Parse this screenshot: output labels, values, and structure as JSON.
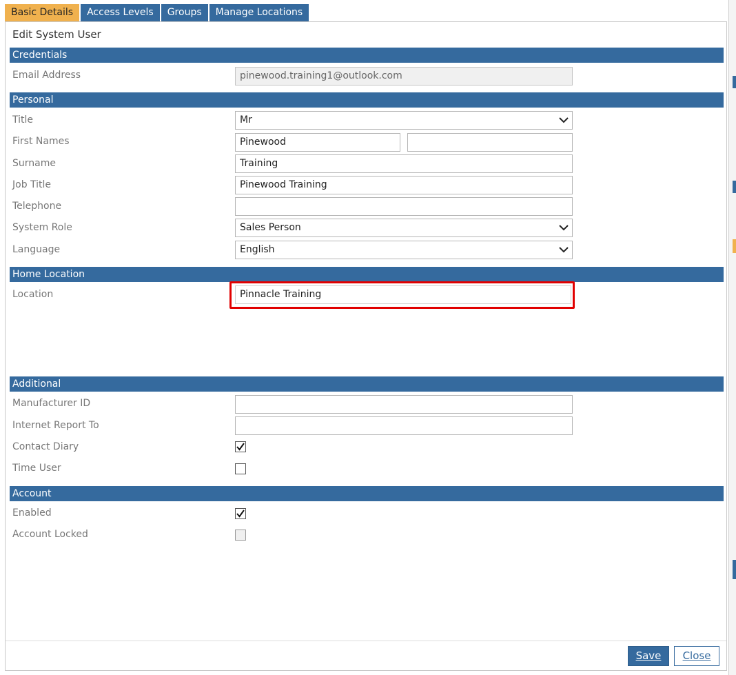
{
  "tabs": [
    {
      "label": "Basic Details",
      "active": true
    },
    {
      "label": "Access Levels",
      "active": false
    },
    {
      "label": "Groups",
      "active": false
    },
    {
      "label": "Manage Locations",
      "active": false
    }
  ],
  "dialog": {
    "title": "Edit System User"
  },
  "credentials": {
    "header": "Credentials",
    "email_label": "Email Address",
    "email_value": "pinewood.training1@outlook.com"
  },
  "personal": {
    "header": "Personal",
    "title_label": "Title",
    "title_value": "Mr",
    "first_names_label": "First Names",
    "first_name_value": "Pinewood",
    "middle_name_value": "",
    "surname_label": "Surname",
    "surname_value": "Training",
    "job_title_label": "Job Title",
    "job_title_value": "Pinewood Training",
    "telephone_label": "Telephone",
    "telephone_value": "",
    "system_role_label": "System Role",
    "system_role_value": "Sales Person",
    "language_label": "Language",
    "language_value": "English"
  },
  "home_location": {
    "header": "Home Location",
    "location_label": "Location",
    "location_value": "Pinnacle Training"
  },
  "additional": {
    "header": "Additional",
    "manufacturer_id_label": "Manufacturer ID",
    "manufacturer_id_value": "",
    "internet_report_to_label": "Internet Report To",
    "internet_report_to_value": "",
    "contact_diary_label": "Contact Diary",
    "contact_diary_checked": true,
    "time_user_label": "Time User",
    "time_user_checked": false
  },
  "account": {
    "header": "Account",
    "enabled_label": "Enabled",
    "enabled_checked": true,
    "account_locked_label": "Account Locked",
    "account_locked_checked": false
  },
  "footer": {
    "save_label": "Save",
    "close_label": "Close"
  },
  "colors": {
    "header_blue": "#356a9e",
    "active_tab": "#f0b14e",
    "highlight_red": "#e10000"
  }
}
